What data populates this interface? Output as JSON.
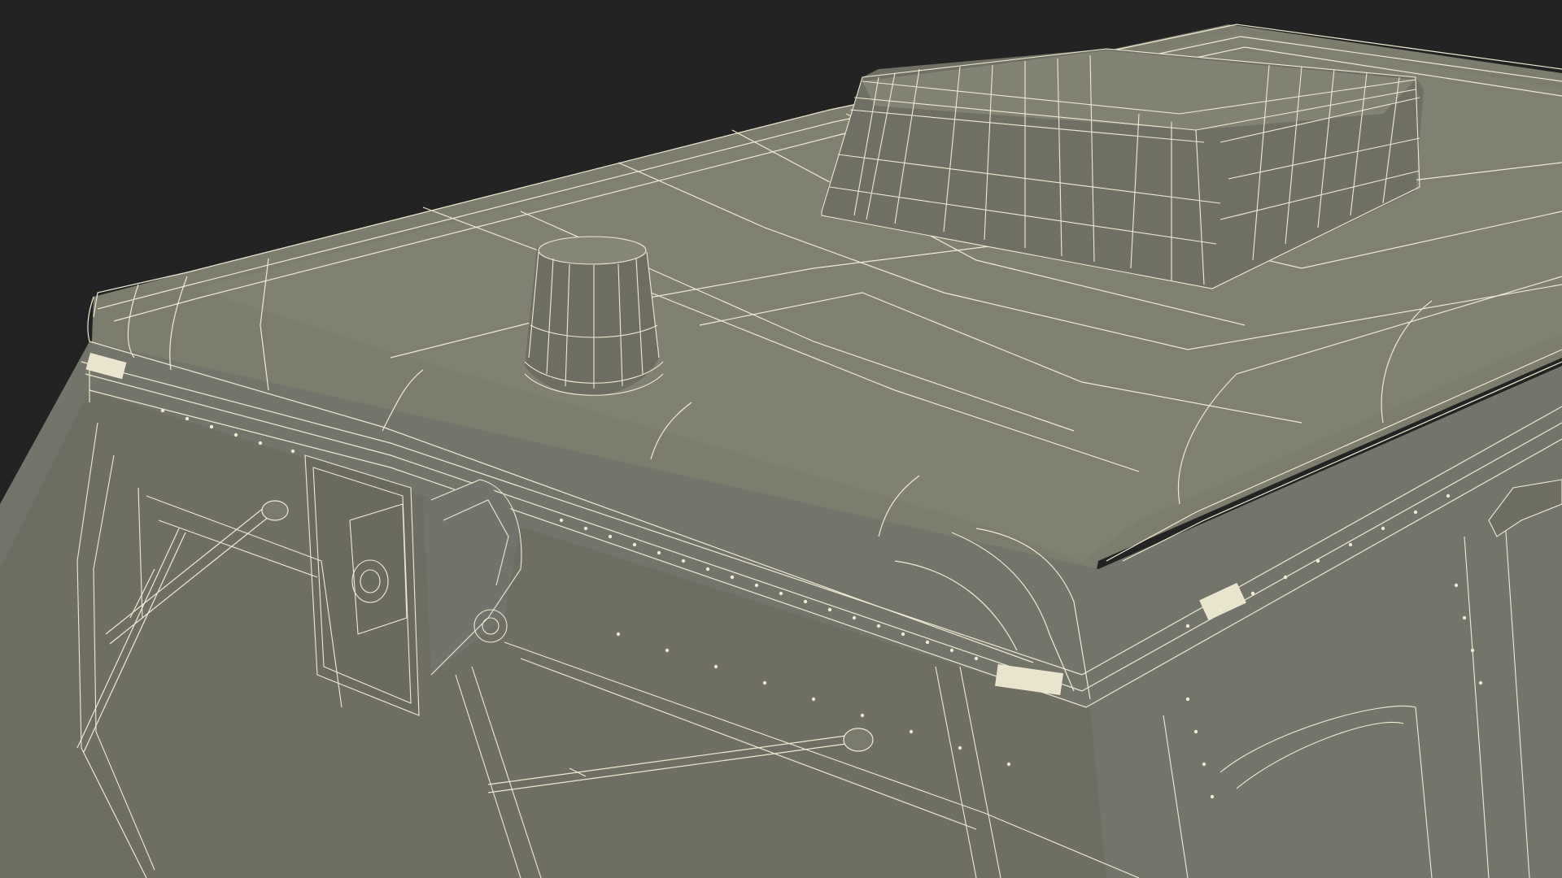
{
  "scene": {
    "subject": "wireframe-render-vehicle-roof",
    "colors": {
      "background": "#232323",
      "surface": "#7c7d6c",
      "surface_light": "#868776",
      "surface_dark": "#6b6c5d",
      "wire": "#f0ead2",
      "wire_dim": "#d6d1ba"
    },
    "components": [
      "roof-panel",
      "air-conditioner-unit",
      "beacon-light",
      "horn-speaker",
      "wiper-arm-left",
      "wiper-arm-right",
      "marker-light",
      "rivets"
    ]
  }
}
